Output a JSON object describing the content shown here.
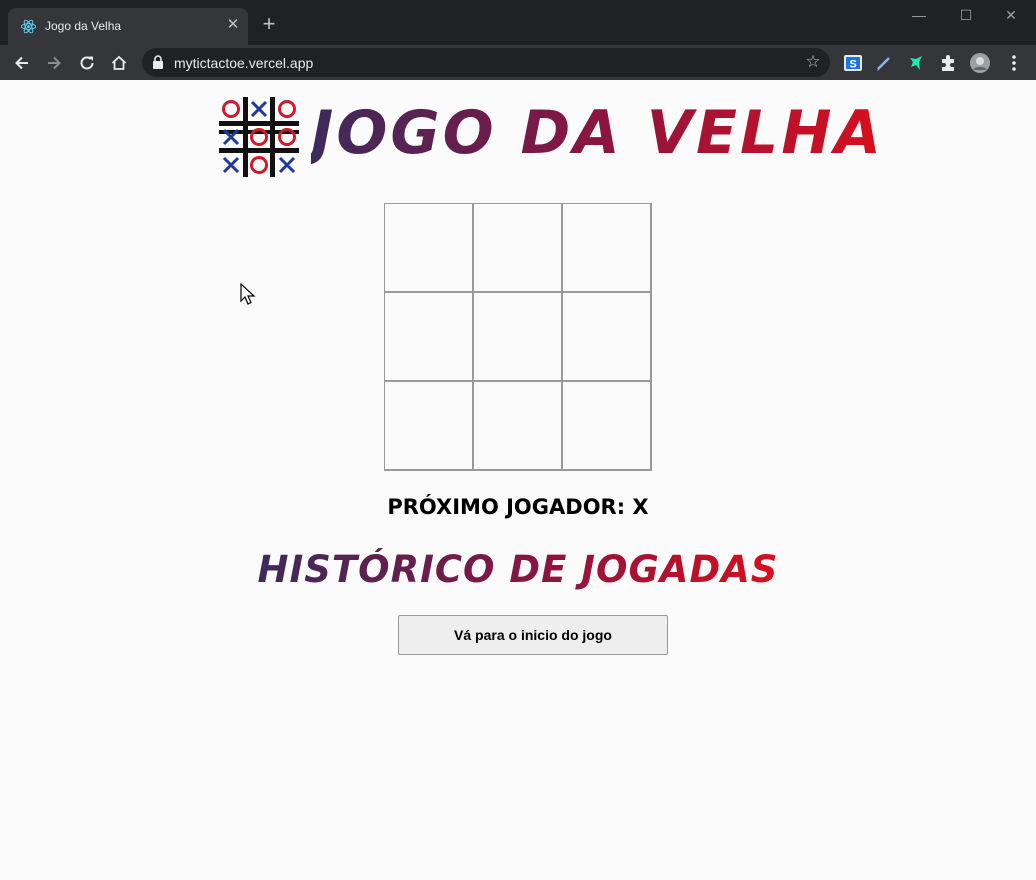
{
  "browser": {
    "tab_title": "Jogo da Velha",
    "url": "mytictactoe.vercel.app",
    "close_glyph": "✕",
    "new_tab_glyph": "+",
    "star_glyph": "☆",
    "window": {
      "minimize": "—",
      "maximize": "☐",
      "close": "✕"
    },
    "icons": [
      "react-favicon-icon",
      "back-icon",
      "forward-icon",
      "reload-icon",
      "home-icon",
      "lock-icon",
      "bookmark-star-icon",
      "extension-s-icon",
      "extension-pen-icon",
      "extension-bird-icon",
      "extensions-puzzle-icon",
      "profile-avatar-icon",
      "menu-kebab-icon"
    ]
  },
  "page": {
    "title": "JOGO DA VELHA",
    "logo_marks": [
      "O",
      "X",
      "O",
      "X",
      "O",
      "O",
      "X",
      "O",
      "X"
    ],
    "board": {
      "squares": [
        "",
        "",
        "",
        "",
        "",
        "",
        "",
        "",
        ""
      ]
    },
    "status": "PRÓXIMO JOGADOR: X",
    "history_title": "HISTÓRICO DE JOGADAS",
    "moves": [
      {
        "label": "Vá para o inicio do jogo"
      }
    ]
  },
  "colors": {
    "chrome_dark": "#202124",
    "chrome_tab": "#35363a",
    "page_bg": "#fbfbfc",
    "grid_line": "#999999",
    "gradient_start": "#3d2a5c",
    "gradient_end": "#d80f1c",
    "logo_x": "#1f3a9e",
    "logo_o": "#d01a2a"
  }
}
